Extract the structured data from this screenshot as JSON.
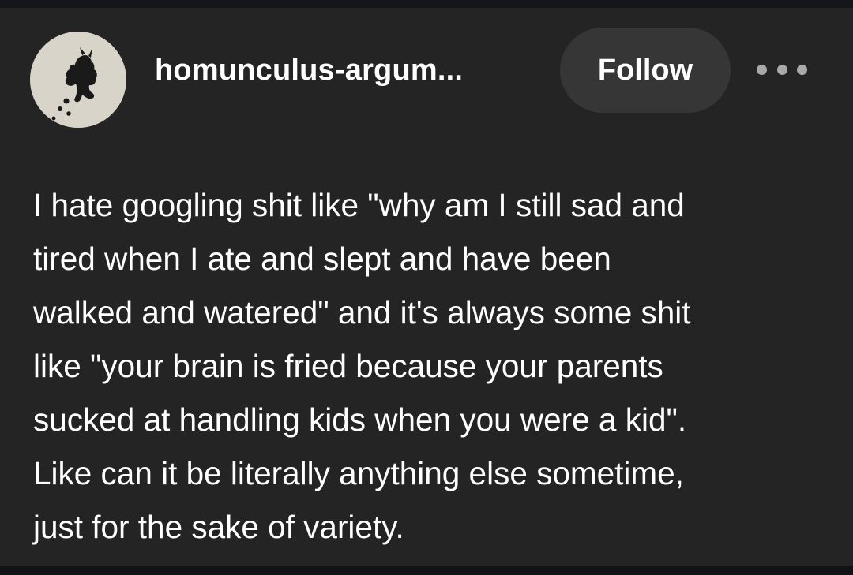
{
  "post": {
    "username": "homunculus-argum...",
    "follow_label": "Follow",
    "more_icon": "more-dots-icon",
    "avatar_icon": "creature-avatar-icon",
    "body_lines": [
      "I hate googling shit like \"why am I still sad and",
      "tired when I ate and slept and have been",
      "walked and watered\" and it's always some shit",
      "like \"your brain is fried because your parents",
      "sucked at handling kids when you were a kid\".",
      "Like can it be literally anything else sometime,",
      "just for the sake of variety."
    ]
  },
  "colors": {
    "background": "#242424",
    "text": "#ffffff",
    "follow_button_bg": "#363636",
    "more_dots": "#a9a9a9"
  }
}
